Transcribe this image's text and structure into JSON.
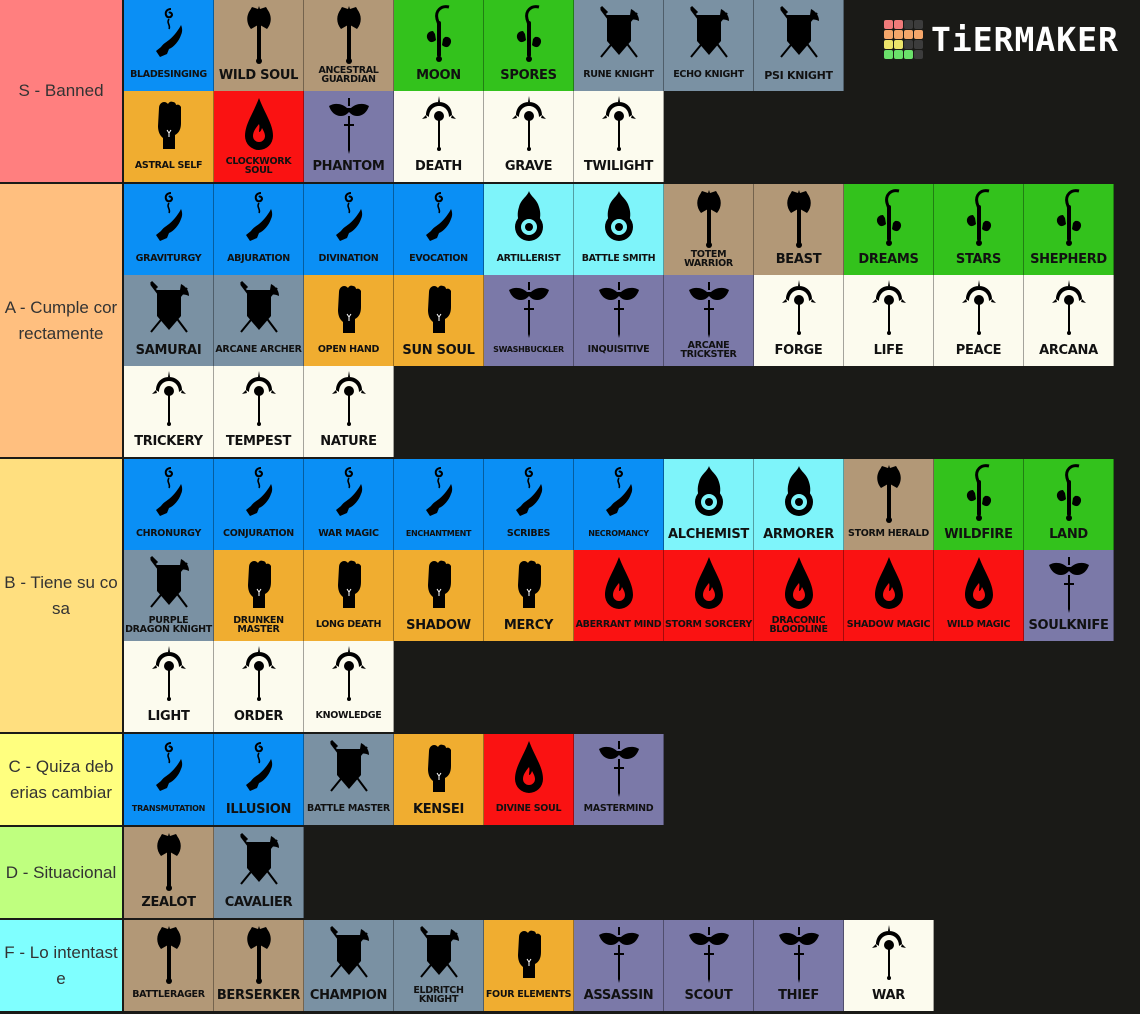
{
  "logo": {
    "text": "TiERMAKER",
    "grid_colors": [
      "#f07a7a",
      "#f07a7a",
      "#3c3c3c",
      "#3c3c3c",
      "#f5a66a",
      "#f5a66a",
      "#f5a66a",
      "#f5a66a",
      "#ece46a",
      "#ece46a",
      "#3c3c3c",
      "#3c3c3c",
      "#6ae06a",
      "#6ae06a",
      "#6ae06a",
      "#3c3c3c"
    ]
  },
  "category_colors": {
    "wizard": "#0a8ff5",
    "barbarian": "#b29877",
    "druid": "#33c21c",
    "fighter": "#7a91a3",
    "monk": "#f0ad30",
    "sorcerer": "#fa1212",
    "rogue": "#7b79a8",
    "cleric": "#fcfbee",
    "artificer": "#7ef4fa"
  },
  "tiers": [
    {
      "label": "S - Banned",
      "color": "#ff7f7f",
      "rows": 2,
      "items": [
        {
          "name": "BLADESINGING",
          "cls": "wizard",
          "size": "sz-s"
        },
        {
          "name": "WILD SOUL",
          "cls": "barbarian",
          "size": "sz-l"
        },
        {
          "name": "ANCESTRAL GUARDIAN",
          "cls": "barbarian",
          "size": "sz-s"
        },
        {
          "name": "MOON",
          "cls": "druid",
          "size": "sz-l"
        },
        {
          "name": "SPORES",
          "cls": "druid",
          "size": "sz-l"
        },
        {
          "name": "RUNE KNIGHT",
          "cls": "fighter",
          "size": "sz-s"
        },
        {
          "name": "ECHO KNIGHT",
          "cls": "fighter",
          "size": "sz-s"
        },
        {
          "name": "PSI KNIGHT",
          "cls": "fighter",
          "size": "sz-m"
        },
        {
          "break": true
        },
        {
          "name": "ASTRAL SELF",
          "cls": "monk",
          "size": "sz-s"
        },
        {
          "name": "CLOCKWORK SOUL",
          "cls": "sorcerer",
          "size": "sz-s"
        },
        {
          "name": "PHANTOM",
          "cls": "rogue",
          "size": "sz-l"
        },
        {
          "name": "DEATH",
          "cls": "cleric",
          "size": "sz-l"
        },
        {
          "name": "GRAVE",
          "cls": "cleric",
          "size": "sz-l"
        },
        {
          "name": "TWILIGHT",
          "cls": "cleric",
          "size": "sz-l"
        }
      ]
    },
    {
      "label": "A - Cumple correctamente",
      "color": "#ffbf7f",
      "rows": 3,
      "items": [
        {
          "name": "GRAVITURGY",
          "cls": "wizard",
          "size": "sz-s"
        },
        {
          "name": "ABJURATION",
          "cls": "wizard",
          "size": "sz-s"
        },
        {
          "name": "DIVINATION",
          "cls": "wizard",
          "size": "sz-s"
        },
        {
          "name": "EVOCATION",
          "cls": "wizard",
          "size": "sz-s"
        },
        {
          "name": "ARTILLERIST",
          "cls": "artificer",
          "size": "sz-s"
        },
        {
          "name": "BATTLE SMITH",
          "cls": "artificer",
          "size": "sz-s"
        },
        {
          "name": "TOTEM WARRIOR",
          "cls": "barbarian",
          "size": "sz-s"
        },
        {
          "name": "BEAST",
          "cls": "barbarian",
          "size": "sz-l"
        },
        {
          "name": "DREAMS",
          "cls": "druid",
          "size": "sz-l"
        },
        {
          "name": "STARS",
          "cls": "druid",
          "size": "sz-l"
        },
        {
          "name": "SHEPHERD",
          "cls": "druid",
          "size": "sz-l"
        },
        {
          "name": "SAMURAI",
          "cls": "fighter",
          "size": "sz-l"
        },
        {
          "name": "ARCANE ARCHER",
          "cls": "fighter",
          "size": "sz-s"
        },
        {
          "name": "OPEN HAND",
          "cls": "monk",
          "size": "sz-s"
        },
        {
          "name": "SUN SOUL",
          "cls": "monk",
          "size": "sz-l"
        },
        {
          "name": "SWASHBUCKLER",
          "cls": "rogue",
          "size": "sz-xs"
        },
        {
          "name": "INQUISITIVE",
          "cls": "rogue",
          "size": "sz-s"
        },
        {
          "name": "ARCANE TRICKSTER",
          "cls": "rogue",
          "size": "sz-s"
        },
        {
          "name": "FORGE",
          "cls": "cleric",
          "size": "sz-l"
        },
        {
          "name": "LIFE",
          "cls": "cleric",
          "size": "sz-l"
        },
        {
          "name": "PEACE",
          "cls": "cleric",
          "size": "sz-l"
        },
        {
          "name": "ARCANA",
          "cls": "cleric",
          "size": "sz-l"
        },
        {
          "name": "TRICKERY",
          "cls": "cleric",
          "size": "sz-l"
        },
        {
          "name": "TEMPEST",
          "cls": "cleric",
          "size": "sz-l"
        },
        {
          "name": "NATURE",
          "cls": "cleric",
          "size": "sz-l"
        }
      ]
    },
    {
      "label": "B - Tiene su cosa",
      "color": "#ffdf7f",
      "rows": 3,
      "items": [
        {
          "name": "CHRONURGY",
          "cls": "wizard",
          "size": "sz-s"
        },
        {
          "name": "CONJURATION",
          "cls": "wizard",
          "size": "sz-s"
        },
        {
          "name": "WAR MAGIC",
          "cls": "wizard",
          "size": "sz-s"
        },
        {
          "name": "ENCHANTMENT",
          "cls": "wizard",
          "size": "sz-xs"
        },
        {
          "name": "SCRIBES",
          "cls": "wizard",
          "size": "sz-s"
        },
        {
          "name": "NECROMANCY",
          "cls": "wizard",
          "size": "sz-xs"
        },
        {
          "name": "ALCHEMIST",
          "cls": "artificer",
          "size": "sz-l"
        },
        {
          "name": "ARMORER",
          "cls": "artificer",
          "size": "sz-l"
        },
        {
          "name": "STORM HERALD",
          "cls": "barbarian",
          "size": "sz-s"
        },
        {
          "name": "WILDFIRE",
          "cls": "druid",
          "size": "sz-l"
        },
        {
          "name": "LAND",
          "cls": "druid",
          "size": "sz-l"
        },
        {
          "name": "PURPLE DRAGON KNIGHT",
          "cls": "fighter",
          "size": "sz-s"
        },
        {
          "name": "DRUNKEN MASTER",
          "cls": "monk",
          "size": "sz-s"
        },
        {
          "name": "LONG DEATH",
          "cls": "monk",
          "size": "sz-s"
        },
        {
          "name": "SHADOW",
          "cls": "monk",
          "size": "sz-l"
        },
        {
          "name": "MERCY",
          "cls": "monk",
          "size": "sz-l"
        },
        {
          "name": "ABERRANT MIND",
          "cls": "sorcerer",
          "size": "sz-s"
        },
        {
          "name": "STORM SORCERY",
          "cls": "sorcerer",
          "size": "sz-s"
        },
        {
          "name": "DRACONIC BLOODLINE",
          "cls": "sorcerer",
          "size": "sz-s"
        },
        {
          "name": "SHADOW MAGIC",
          "cls": "sorcerer",
          "size": "sz-s"
        },
        {
          "name": "WILD MAGIC",
          "cls": "sorcerer",
          "size": "sz-s"
        },
        {
          "name": "SOULKNIFE",
          "cls": "rogue",
          "size": "sz-l"
        },
        {
          "name": "LIGHT",
          "cls": "cleric",
          "size": "sz-l"
        },
        {
          "name": "ORDER",
          "cls": "cleric",
          "size": "sz-l"
        },
        {
          "name": "KNOWLEDGE",
          "cls": "cleric",
          "size": "sz-s"
        }
      ]
    },
    {
      "label": "C - Quiza deberias cambiar",
      "color": "#ffff7f",
      "rows": 1,
      "items": [
        {
          "name": "TRANSMUTATION",
          "cls": "wizard",
          "size": "sz-xs"
        },
        {
          "name": "ILLUSION",
          "cls": "wizard",
          "size": "sz-l"
        },
        {
          "name": "BATTLE MASTER",
          "cls": "fighter",
          "size": "sz-s"
        },
        {
          "name": "KENSEI",
          "cls": "monk",
          "size": "sz-l"
        },
        {
          "name": "DIVINE SOUL",
          "cls": "sorcerer",
          "size": "sz-s"
        },
        {
          "name": "MASTERMIND",
          "cls": "rogue",
          "size": "sz-s"
        }
      ]
    },
    {
      "label": "D - Situacional",
      "color": "#bfff7f",
      "rows": 1,
      "items": [
        {
          "name": "ZEALOT",
          "cls": "barbarian",
          "size": "sz-l"
        },
        {
          "name": "CAVALIER",
          "cls": "fighter",
          "size": "sz-l"
        }
      ]
    },
    {
      "label": "F - Lo intentaste",
      "color": "#7fffff",
      "rows": 1,
      "items": [
        {
          "name": "BATTLERAGER",
          "cls": "barbarian",
          "size": "sz-s"
        },
        {
          "name": "BERSERKER",
          "cls": "barbarian",
          "size": "sz-l"
        },
        {
          "name": "CHAMPION",
          "cls": "fighter",
          "size": "sz-l"
        },
        {
          "name": "ELDRITCH KNIGHT",
          "cls": "fighter",
          "size": "sz-s"
        },
        {
          "name": "FOUR ELEMENTS",
          "cls": "monk",
          "size": "sz-s"
        },
        {
          "name": "ASSASSIN",
          "cls": "rogue",
          "size": "sz-l"
        },
        {
          "name": "SCOUT",
          "cls": "rogue",
          "size": "sz-l"
        },
        {
          "name": "THIEF",
          "cls": "rogue",
          "size": "sz-l"
        },
        {
          "name": "WAR",
          "cls": "cleric",
          "size": "sz-l"
        }
      ]
    }
  ],
  "icons": {
    "wizard": "hand-spell-icon",
    "barbarian": "battle-axe-icon",
    "druid": "sickle-leaves-icon",
    "fighter": "shield-swords-icon",
    "monk": "fist-icon",
    "sorcerer": "flame-drop-icon",
    "rogue": "mask-dagger-icon",
    "cleric": "holy-mace-icon",
    "artificer": "flaming-gear-icon"
  }
}
